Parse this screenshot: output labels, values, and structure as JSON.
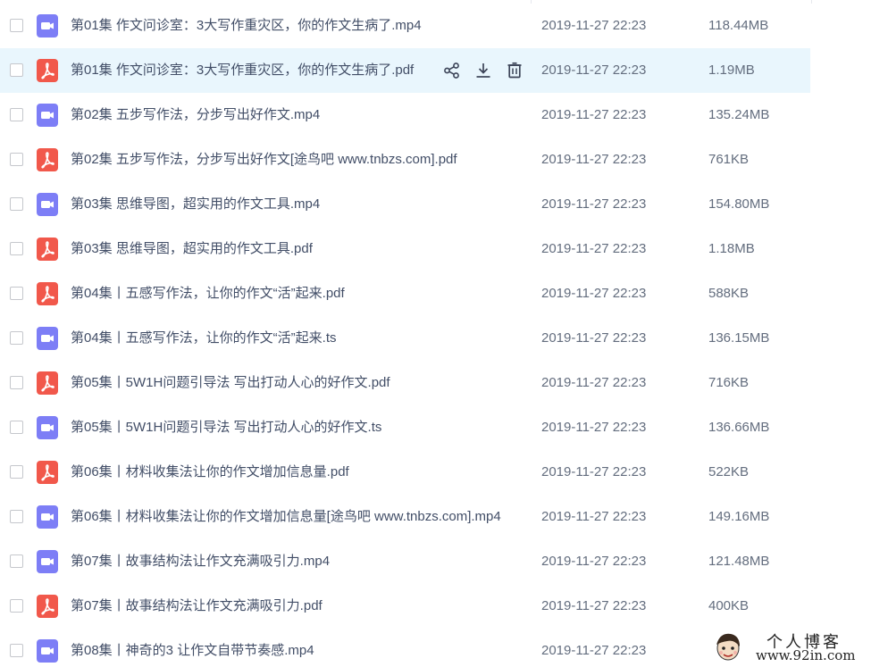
{
  "colors": {
    "video_icon": "#7d7ef6",
    "pdf_icon": "#f1584b",
    "selected_row": "#e9f6fd",
    "name_text": "#424e67",
    "meta_text": "#636d7e"
  },
  "row_actions": {
    "share": "share-icon",
    "download": "download-icon",
    "delete": "trash-icon"
  },
  "files": [
    {
      "type": "video",
      "name": "第01集  作文问诊室：3大写作重灾区，你的作文生病了.mp4",
      "date": "2019-11-27 22:23",
      "size": "118.44MB",
      "selected": false
    },
    {
      "type": "pdf",
      "name": "第01集  作文问诊室：3大写作重灾区，你的作文生病了.pdf",
      "date": "2019-11-27 22:23",
      "size": "1.19MB",
      "selected": true
    },
    {
      "type": "video",
      "name": "第02集  五步写作法，分步写出好作文.mp4",
      "date": "2019-11-27 22:23",
      "size": "135.24MB",
      "selected": false
    },
    {
      "type": "pdf",
      "name": "第02集  五步写作法，分步写出好作文[途鸟吧 www.tnbzs.com].pdf",
      "date": "2019-11-27 22:23",
      "size": "761KB",
      "selected": false
    },
    {
      "type": "video",
      "name": "第03集  思维导图，超实用的作文工具.mp4",
      "date": "2019-11-27 22:23",
      "size": "154.80MB",
      "selected": false
    },
    {
      "type": "pdf",
      "name": "第03集  思维导图，超实用的作文工具.pdf",
      "date": "2019-11-27 22:23",
      "size": "1.18MB",
      "selected": false
    },
    {
      "type": "pdf",
      "name": "第04集丨五感写作法，让你的作文“活”起来.pdf",
      "date": "2019-11-27 22:23",
      "size": "588KB",
      "selected": false
    },
    {
      "type": "video",
      "name": "第04集丨五感写作法，让你的作文“活”起来.ts",
      "date": "2019-11-27 22:23",
      "size": "136.15MB",
      "selected": false
    },
    {
      "type": "pdf",
      "name": "第05集丨5W1H问题引导法 写出打动人心的好作文.pdf",
      "date": "2019-11-27 22:23",
      "size": "716KB",
      "selected": false
    },
    {
      "type": "video",
      "name": "第05集丨5W1H问题引导法 写出打动人心的好作文.ts",
      "date": "2019-11-27 22:23",
      "size": "136.66MB",
      "selected": false
    },
    {
      "type": "pdf",
      "name": "第06集丨材料收集法让你的作文增加信息量.pdf",
      "date": "2019-11-27 22:23",
      "size": "522KB",
      "selected": false
    },
    {
      "type": "video",
      "name": "第06集丨材料收集法让你的作文增加信息量[途鸟吧 www.tnbzs.com].mp4",
      "date": "2019-11-27 22:23",
      "size": "149.16MB",
      "selected": false
    },
    {
      "type": "video",
      "name": "第07集丨故事结构法让作文充满吸引力.mp4",
      "date": "2019-11-27 22:23",
      "size": "121.48MB",
      "selected": false
    },
    {
      "type": "pdf",
      "name": "第07集丨故事结构法让作文充满吸引力.pdf",
      "date": "2019-11-27 22:23",
      "size": "400KB",
      "selected": false
    },
    {
      "type": "video",
      "name": "第08集丨神奇的3 让作文自带节奏感.mp4",
      "date": "2019-11-27 22:23",
      "size": "",
      "selected": false
    }
  ],
  "watermark": {
    "title": "个人博客",
    "url": "www.92in.com"
  }
}
